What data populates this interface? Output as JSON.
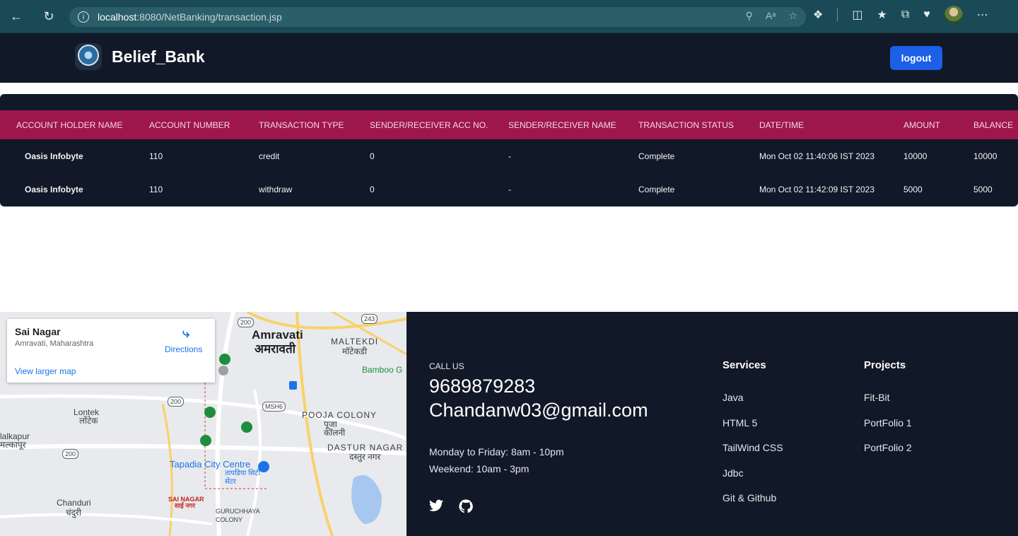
{
  "browser": {
    "url_host": "localhost",
    "url_path": ":8080/NetBanking/transaction.jsp",
    "info_glyph": "i"
  },
  "header": {
    "brand": "Belief_Bank",
    "logout_label": "logout"
  },
  "table": {
    "columns": [
      "ACCOUNT HOLDER NAME",
      "ACCOUNT NUMBER",
      "TRANSACTION TYPE",
      "SENDER/RECEIVER ACC NO.",
      "SENDER/RECEIVER NAME",
      "TRANSACTION STATUS",
      "DATE/TIME",
      "AMOUNT",
      "BALANCE"
    ],
    "rows": [
      [
        "Oasis Infobyte",
        "110",
        "credit",
        "0",
        "-",
        "Complete",
        "Mon Oct 02 11:40:06 IST 2023",
        "10000",
        "10000"
      ],
      [
        "Oasis Infobyte",
        "110",
        "withdraw",
        "0",
        "-",
        "Complete",
        "Mon Oct 02 11:42:09 IST 2023",
        "5000",
        "5000"
      ]
    ]
  },
  "map": {
    "place": "Sai Nagar",
    "region": "Amravati, Maharashtra",
    "directions_label": "Directions",
    "larger_map_label": "View larger map",
    "labels": {
      "amravati_en": "Amravati",
      "amravati_hi": "अमरावती",
      "maltekdi_en": "MALTEKDI",
      "maltekdi_hi": "मॉटेकडी",
      "bamboo": "Bamboo G",
      "lontek_en": "Lontek",
      "lontek_hi": "लोंटेक",
      "malkapur_en": "lalkapur",
      "malkapur_hi": "मल्कापूर",
      "pooja_en": "POOJA COLONY",
      "pooja_hi": "पूजा कॉलनी",
      "dastur_en": "DASTUR NAGAR",
      "dastur_hi": "दस्तुर नगर",
      "tapadia_en": "Tapadia City Centre",
      "tapadia_hi": "तापडिया सिटी सेंटर",
      "chanduri_en": "Chanduri",
      "chanduri_hi": "चंदुरी",
      "sainagar_en": "SAI NAGAR",
      "sainagar_hi": "साई नगर",
      "guruchhaya_en": "GURUCHHAYA COLONY",
      "road_200a": "200",
      "road_200b": "200",
      "road_200c": "200",
      "road_243": "243",
      "road_mshe": "MSH6"
    }
  },
  "contact": {
    "call_us": "CALL US",
    "phone": "9689879283",
    "email": "Chandanw03@gmail.com",
    "hours_weekday": "Monday to Friday: 8am - 10pm",
    "hours_weekend": "Weekend: 10am - 3pm",
    "icons": [
      "twitter-icon",
      "github-icon"
    ]
  },
  "services": {
    "title": "Services",
    "items": [
      "Java",
      "HTML 5",
      "TailWind CSS",
      "Jdbc",
      "Git & Github"
    ]
  },
  "projects": {
    "title": "Projects",
    "items": [
      "Fit-Bit",
      "PortFolio 1",
      "PortFolio 2"
    ]
  },
  "colors": {
    "header_bg": "#111827",
    "table_header": "#9d174d",
    "logout": "#1d5fe6",
    "browser": "#1a4a55"
  }
}
